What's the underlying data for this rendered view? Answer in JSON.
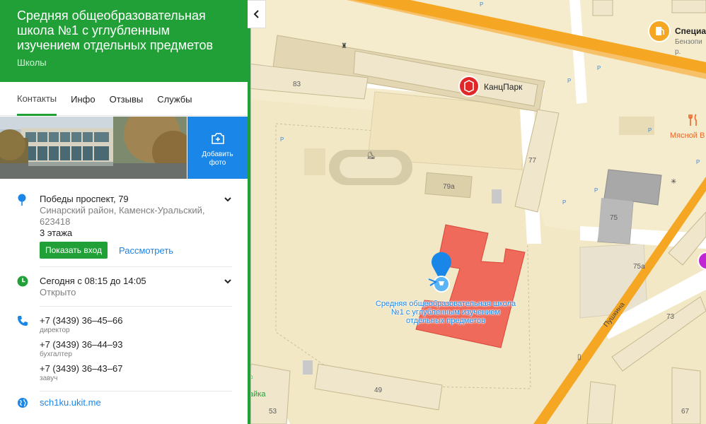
{
  "header": {
    "title": "Средняя общеобразовательная школа №1 с углубленным изучением отдельных предметов",
    "category": "Школы"
  },
  "tabs": [
    {
      "label": "Контакты",
      "active": true
    },
    {
      "label": "Инфо",
      "active": false
    },
    {
      "label": "Отзывы",
      "active": false
    },
    {
      "label": "Службы",
      "active": false
    }
  ],
  "add_photo_label": "Добавить фото",
  "address": {
    "main": "Победы проспект, 79",
    "district": "Синарский район, Каменск-Уральский, 623418",
    "floors": "3 этажа",
    "entrance_button": "Показать вход",
    "view_link": "Рассмотреть"
  },
  "hours": {
    "schedule": "Сегодня с 08:15 до 14:05",
    "status": "Открыто"
  },
  "phones": [
    {
      "number": "+7 (3439) 36–45–66",
      "role": "директор"
    },
    {
      "number": "+7 (3439) 36–44–93",
      "role": "бухгалтер"
    },
    {
      "number": "+7 (3439) 36–43–67",
      "role": "завуч"
    }
  ],
  "website": "sch1ku.ukit.me",
  "map": {
    "school_label": "Средняя общеобразовательная школа №1 с углубленным изучением отдельных предметов",
    "pois": {
      "kanzpark": "КанцПарк",
      "special": "Специа",
      "special_sub": "Бензопи",
      "special_sub2": "р.",
      "meat": "Мясной В",
      "lavka": "айка"
    },
    "house_numbers": [
      "83",
      "77",
      "79а",
      "75",
      "75а",
      "73",
      "49",
      "53",
      "67"
    ],
    "street": "Пушкина",
    "colors": {
      "accent_green": "#21a038",
      "link_blue": "#1a86e8",
      "building_red": "#ef6a5a",
      "road_orange": "#f5a623",
      "map_bg": "#f5ebcd"
    }
  }
}
